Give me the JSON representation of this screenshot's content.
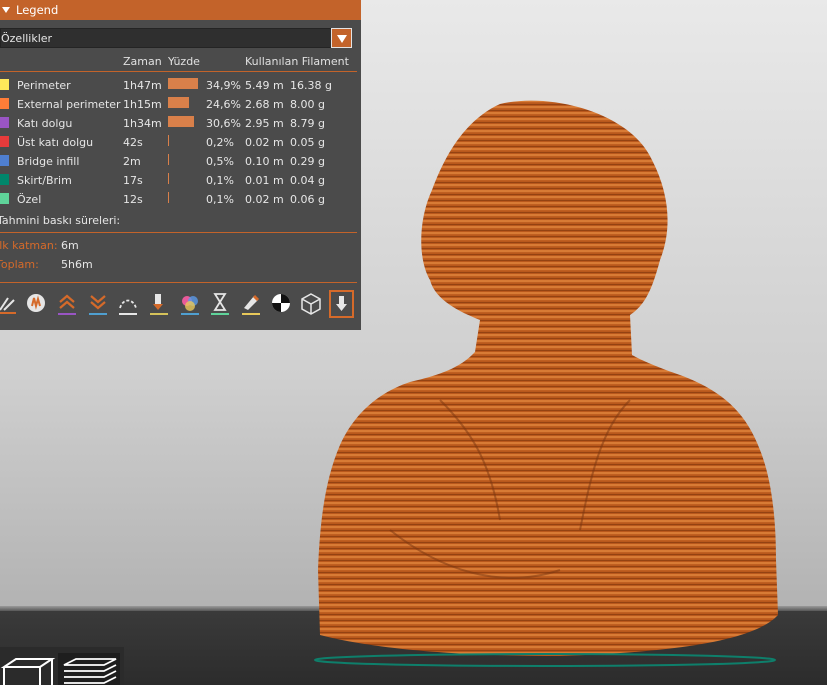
{
  "legend": {
    "title": "Legend",
    "view_type": "Özellikler",
    "columns": {
      "time": "Zaman",
      "percent": "Yüzde",
      "filament": "Kullanılan Filament"
    },
    "rows": [
      {
        "name": "Perimeter",
        "time": "1h47m",
        "percent": "34,9%",
        "fraction": 0.349,
        "length": "5.49 m",
        "weight": "16.38 g",
        "color": "#ffe95a"
      },
      {
        "name": "External perimeter",
        "time": "1h15m",
        "percent": "24,6%",
        "fraction": 0.246,
        "length": "2.68 m",
        "weight": "8.00 g",
        "color": "#ff7d38"
      },
      {
        "name": "Katı dolgu",
        "time": "1h34m",
        "percent": "30,6%",
        "fraction": 0.306,
        "length": "2.95 m",
        "weight": "8.79 g",
        "color": "#9955c4"
      },
      {
        "name": "Üst katı dolgu",
        "time": "42s",
        "percent": "0,2%",
        "fraction": 0.002,
        "length": "0.02 m",
        "weight": "0.05 g",
        "color": "#e63b3b"
      },
      {
        "name": "Bridge infill",
        "time": "2m",
        "percent": "0,5%",
        "fraction": 0.005,
        "length": "0.10 m",
        "weight": "0.29 g",
        "color": "#4f7fd0"
      },
      {
        "name": "Skirt/Brim",
        "time": "17s",
        "percent": "0,1%",
        "fraction": 0.001,
        "length": "0.01 m",
        "weight": "0.04 g",
        "color": "#00866b"
      },
      {
        "name": "Özel",
        "time": "12s",
        "percent": "0,1%",
        "fraction": 0.001,
        "length": "0.02 m",
        "weight": "0.06 g",
        "color": "#5fd39a"
      }
    ],
    "estimate_label": "Tahmini baskı süreleri:",
    "first_layer_label": "İlk katman:",
    "first_layer_value": "6m",
    "total_label": "Toplam:",
    "total_value": "5h6m"
  },
  "toolbar_icons": [
    "travel-icon",
    "wipe-icon",
    "retractions-icon",
    "deretractions-icon",
    "seams-icon",
    "tool-change-icon",
    "color-change-icon",
    "pause-icon",
    "custom-gcode-icon",
    "center-of-gravity-icon",
    "shells-icon",
    "tool-marker-icon"
  ]
}
